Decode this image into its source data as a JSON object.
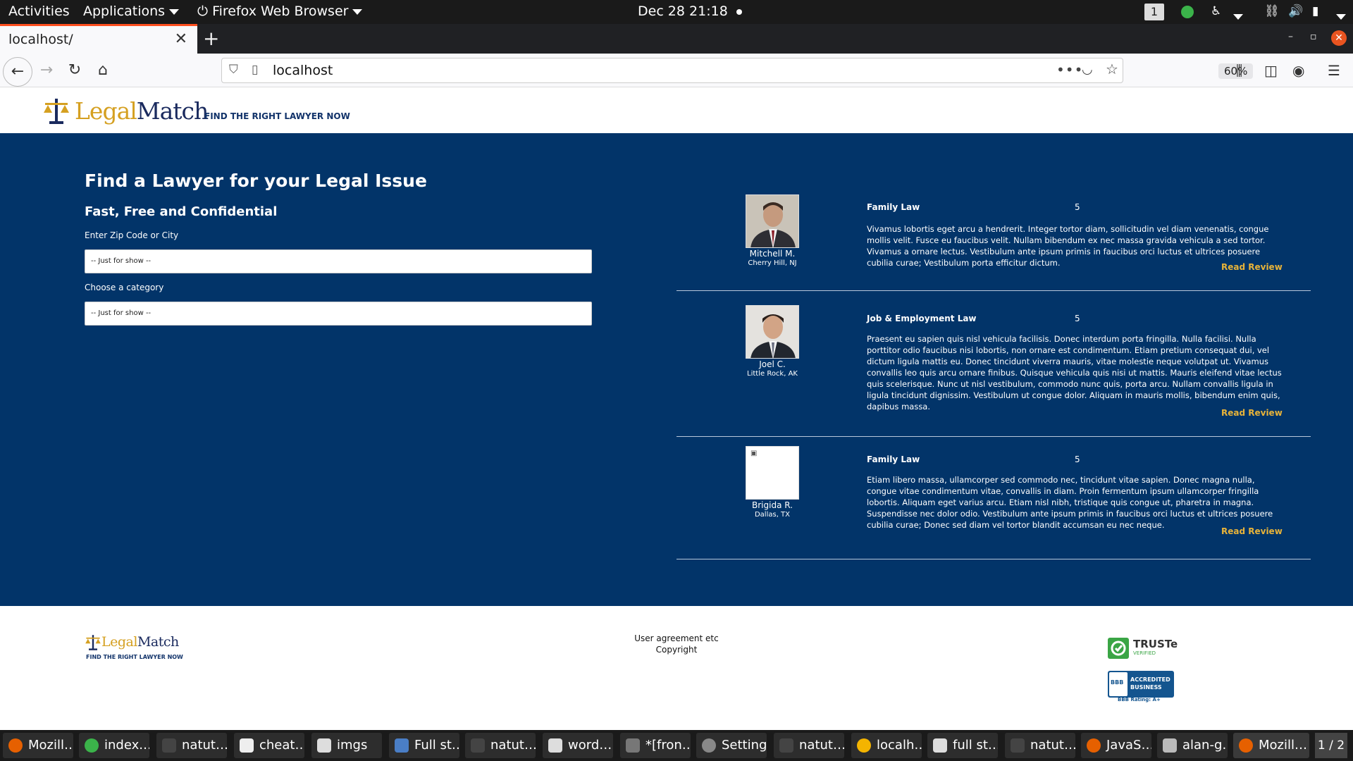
{
  "system": {
    "activities": "Activities",
    "applications": "Applications",
    "firefox_menu": "Firefox Web Browser",
    "clock": "Dec 28  21:18",
    "workspace": "1"
  },
  "browser": {
    "tab_title": "localhost/",
    "url": "localhost",
    "zoom": "60%"
  },
  "site": {
    "logo_legal": "Legal",
    "logo_match": "Match",
    "tagline": "FIND THE RIGHT LAWYER NOW"
  },
  "search": {
    "heading": "Find a Lawyer for your Legal Issue",
    "subheading": "Fast, Free and Confidential",
    "zip_label": "Enter Zip Code or City",
    "zip_value": "-- Just for show --",
    "category_label": "Choose a category",
    "category_value": "-- Just for show --"
  },
  "reviews": [
    {
      "name": "Mitchell M.",
      "city": "Cherry Hill, NJ",
      "type": "Family Law",
      "score": "5",
      "text": "Vivamus lobortis eget arcu a hendrerit. Integer tortor diam, sollicitudin vel diam venenatis, congue mollis velit. Fusce eu faucibus velit. Nullam bibendum ex nec massa gravida vehicula a sed tortor. Vivamus a ornare lectus. Vestibulum ante ipsum primis in faucibus orci luctus et ultrices posuere cubilia curae; Vestibulum porta efficitur dictum.",
      "link": "Read Review"
    },
    {
      "name": "Joel C.",
      "city": "Little Rock, AK",
      "type": "Job & Employment Law",
      "score": "5",
      "text": "Praesent eu sapien quis nisl vehicula facilisis. Donec interdum porta fringilla. Nulla facilisi. Nulla porttitor odio faucibus nisi lobortis, non ornare est condimentum. Etiam pretium consequat dui, vel dictum ligula mattis eu. Donec tincidunt viverra mauris, vitae molestie neque volutpat ut. Vivamus convallis leo quis arcu ornare finibus. Quisque vehicula quis nisi ut mattis. Mauris eleifend vitae lectus quis scelerisque. Nunc ut nisl vestibulum, commodo nunc quis, porta arcu. Nullam convallis ligula in ligula tincidunt dignissim. Vestibulum ut congue dolor. Aliquam in mauris mollis, bibendum enim quis, dapibus massa.",
      "link": "Read Review"
    },
    {
      "name": "Brigida R.",
      "city": "Dallas, TX",
      "type": "Family Law",
      "score": "5",
      "text": "Etiam libero massa, ullamcorper sed commodo nec, tincidunt vitae sapien. Donec magna nulla, congue vitae condimentum vitae, convallis in diam. Proin fermentum ipsum ullamcorper fringilla lobortis. Aliquam eget varius arcu. Etiam nisl nibh, tristique quis congue ut, pharetra in magna. Suspendisse nec dolor odio. Vestibulum ante ipsum primis in faucibus orci luctus et ultrices posuere cubilia curae; Donec sed diam vel tortor blandit accumsan eu nec neque.",
      "link": "Read Review"
    }
  ],
  "footer": {
    "line1": "User agreement etc",
    "line2": "Copyright",
    "truste": "TRUSTe",
    "truste_sub": "VERIFIED",
    "bbb_line1": "ACCREDITED",
    "bbb_line2": "BUSINESS",
    "bbb_rating": "BBB Rating: A+"
  },
  "taskbar": {
    "items": [
      "Mozill…",
      "index.…",
      "natut…",
      "cheat…",
      "imgs",
      "Full st…",
      "natut…",
      "word…",
      "*[fron…",
      "Settings",
      "natut…",
      "localh…",
      "full st…",
      "natut…",
      "JavaS…",
      "alan-g…",
      "Mozill…"
    ],
    "pager": "1 / 2"
  },
  "colors": {
    "brand_blue": "#023469",
    "brand_gold": "#d5a021",
    "link_gold": "#e8b339"
  }
}
